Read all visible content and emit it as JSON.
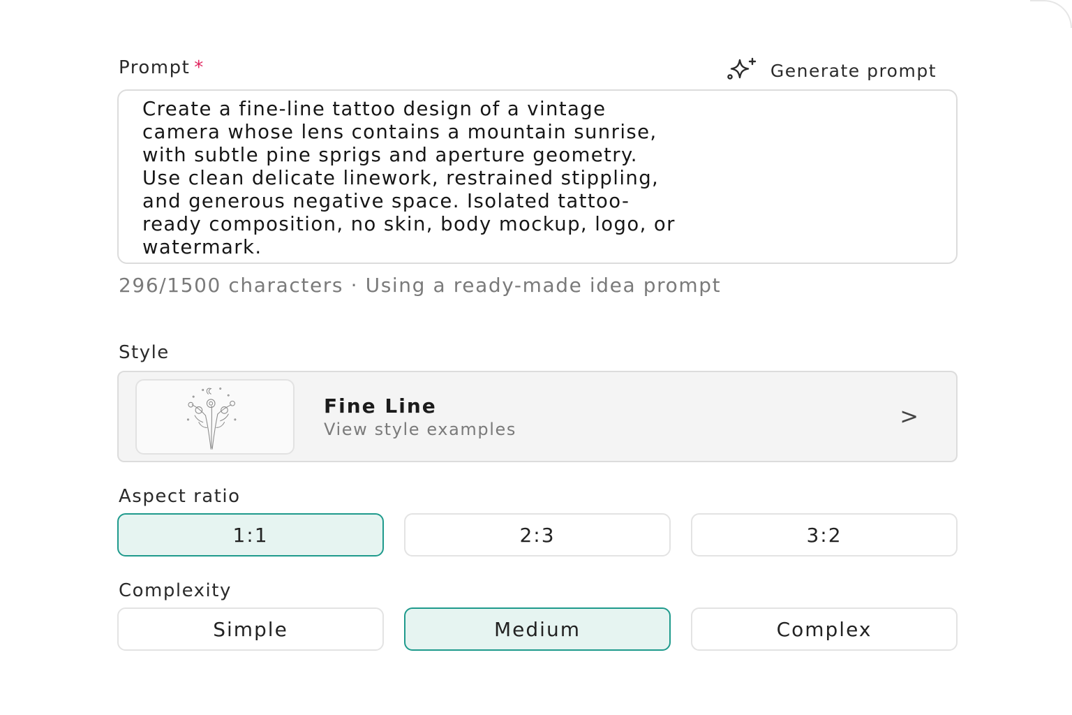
{
  "prompt": {
    "label": "Prompt",
    "required_mark": "*",
    "generate_label": "Generate prompt",
    "generate_icon": "sparkles-icon",
    "value": "Create a fine-line tattoo design of a vintage\ncamera whose lens contains a mountain sunrise,\nwith subtle pine sprigs and aperture geometry.\nUse clean delicate linework, restrained stippling,\nand generous negative space. Isolated tattoo-\nready composition, no skin, body mockup, logo, or\nwatermark.",
    "status": "296/1500 characters · Using a ready-made idea prompt"
  },
  "style": {
    "label": "Style",
    "name": "Fine Line",
    "subtitle": "View style examples",
    "chevron": ">",
    "thumbnail": "floral-line-drawing"
  },
  "aspect_ratio": {
    "label": "Aspect ratio",
    "options": [
      "1:1",
      "2:3",
      "3:2"
    ],
    "selected": "1:1"
  },
  "complexity": {
    "label": "Complexity",
    "options": [
      "Simple",
      "Medium",
      "Complex"
    ],
    "selected": "Medium"
  },
  "colors": {
    "accent": "#1e9a8c",
    "selected_bg": "#e6f4f1",
    "required": "#e0245e"
  }
}
